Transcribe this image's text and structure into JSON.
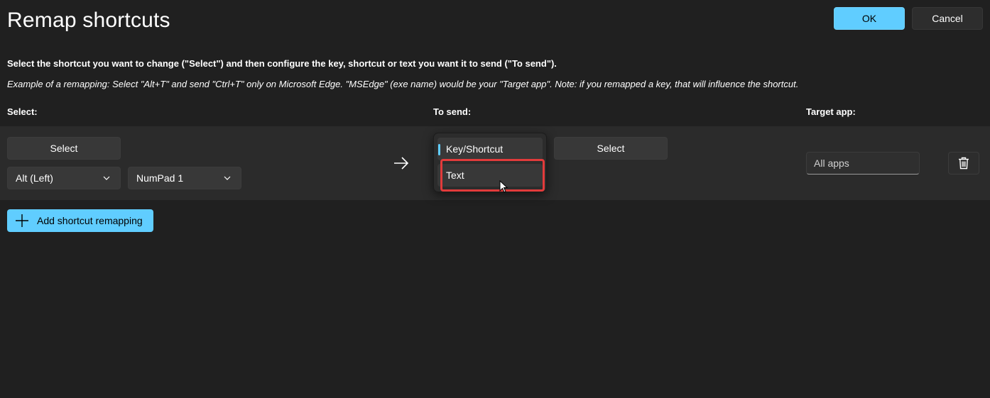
{
  "window": {
    "title": "Remap shortcuts",
    "ok_label": "OK",
    "cancel_label": "Cancel"
  },
  "instructions": {
    "main": "Select the shortcut you want to change (\"Select\") and then configure the key, shortcut or text you want it to send (\"To send\").",
    "example": "Example of a remapping: Select \"Alt+T\" and send \"Ctrl+T\" only on Microsoft Edge. \"MSEdge\" (exe name) would be your \"Target app\". Note: if you remapped a key, that will influence the shortcut."
  },
  "columns": {
    "select": "Select:",
    "to_send": "To send:",
    "target_app": "Target app:"
  },
  "row": {
    "select_button": "Select",
    "modifier_value": "Alt (Left)",
    "key_value": "NumPad 1",
    "send_type_options": [
      "Key/Shortcut",
      "Text"
    ],
    "send_select_button": "Select",
    "target_app_value": "All apps"
  },
  "add_button_label": "Add shortcut remapping",
  "icons": {
    "arrow": "arrow-right-icon",
    "delete": "trash-icon",
    "add": "plus-icon",
    "chevron": "chevron-down-icon"
  },
  "colors": {
    "accent": "#60cdff",
    "background": "#202020",
    "row_background": "#2b2b2b",
    "highlight": "#e23b3b"
  }
}
